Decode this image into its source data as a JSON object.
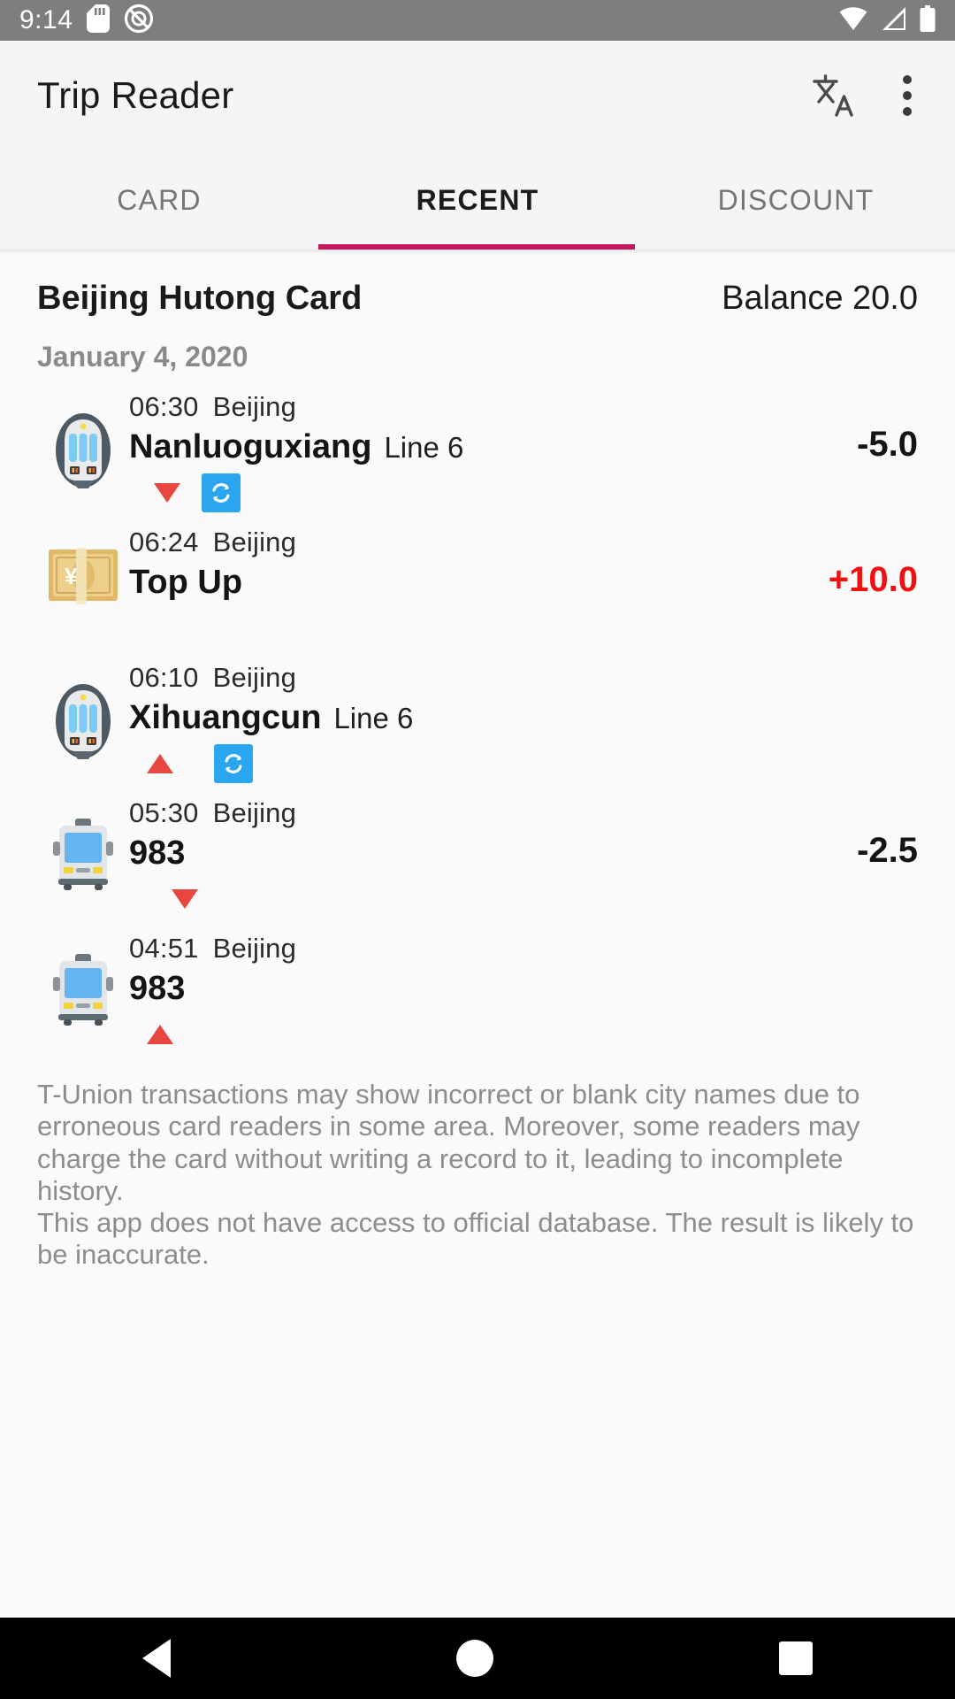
{
  "status_bar": {
    "time": "9:14",
    "icons_left": [
      "sd-card-icon",
      "do-not-disturb-icon"
    ],
    "icons_right": [
      "wifi-icon",
      "cellular-signal-icon",
      "battery-icon"
    ]
  },
  "app_bar": {
    "title": "Trip Reader",
    "translate_icon": "translate-icon",
    "overflow_icon": "more-vertical-icon"
  },
  "tabs": [
    {
      "label": "CARD",
      "active": false
    },
    {
      "label": "RECENT",
      "active": true
    },
    {
      "label": "DISCOUNT",
      "active": false
    }
  ],
  "tab_indicator_color": "#c2185b",
  "card": {
    "name": "Beijing Hutong Card",
    "balance_label": "Balance 20.0"
  },
  "date_header": "January 4, 2020",
  "transactions": [
    {
      "icon": "metro-icon",
      "time": "06:30",
      "city": "Beijing",
      "name": "Nanluoguxiang",
      "line": "Line 6",
      "amount": "-5.0",
      "amount_kind": "debit",
      "direction": "out",
      "transfer": true
    },
    {
      "icon": "banknote-icon",
      "time": "06:24",
      "city": "Beijing",
      "name": "Top Up",
      "line": "",
      "amount": "+10.0",
      "amount_kind": "credit",
      "direction": "",
      "transfer": false
    },
    {
      "icon": "metro-icon",
      "time": "06:10",
      "city": "Beijing",
      "name": "Xihuangcun",
      "line": "Line 6",
      "amount": "",
      "amount_kind": "debit",
      "direction": "in",
      "transfer": true
    },
    {
      "icon": "bus-icon",
      "time": "05:30",
      "city": "Beijing",
      "name": "983",
      "line": "",
      "amount": "-2.5",
      "amount_kind": "debit",
      "direction": "out",
      "transfer": false
    },
    {
      "icon": "bus-icon",
      "time": "04:51",
      "city": "Beijing",
      "name": "983",
      "line": "",
      "amount": "",
      "amount_kind": "debit",
      "direction": "in",
      "transfer": false
    }
  ],
  "disclaimer": {
    "paragraph1": "T-Union transactions may show incorrect or blank city names due to erroneous card readers in some area. Moreover, some readers may charge the card without writing a record to it, leading to incomplete history.",
    "paragraph2": "This app does not have access to official database. The result is likely to be inaccurate."
  },
  "nav_bar": {
    "back": "back-icon",
    "home": "home-icon",
    "recents": "recents-icon"
  },
  "colors": {
    "accent": "#c2185b",
    "credit": "#f01010",
    "transfer_badge": "#2aa6f0",
    "direction_marker": "#e8473f"
  }
}
